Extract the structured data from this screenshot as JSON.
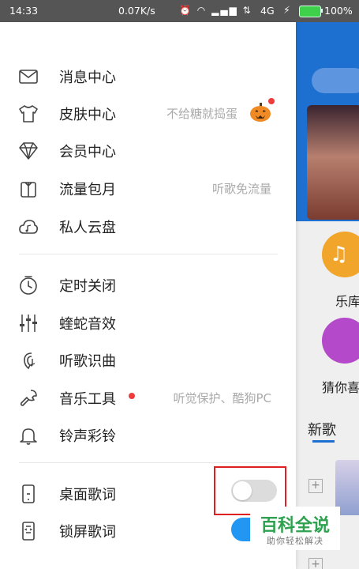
{
  "status_bar": {
    "time": "14:33",
    "net_speed": "0.07K/s",
    "network": "4G",
    "battery": "100%",
    "battery_level": 1.0
  },
  "drawer": {
    "group1": [
      {
        "label": "消息中心",
        "hint": "",
        "icon": "mail-icon"
      },
      {
        "label": "皮肤中心",
        "hint": "不给糖就捣蛋",
        "icon": "tshirt-icon"
      },
      {
        "label": "会员中心",
        "hint": "",
        "icon": "diamond-icon"
      },
      {
        "label": "流量包月",
        "hint": "听歌免流量",
        "icon": "gift-icon"
      },
      {
        "label": "私人云盘",
        "hint": "",
        "icon": "cloud-music-icon"
      }
    ],
    "group2": [
      {
        "label": "定时关闭",
        "hint": "",
        "icon": "timer-icon"
      },
      {
        "label": "蝰蛇音效",
        "hint": "",
        "icon": "equalizer-icon"
      },
      {
        "label": "听歌识曲",
        "hint": "",
        "icon": "mic-music-icon"
      },
      {
        "label": "音乐工具",
        "hint": "听觉保护、酷狗PC",
        "icon": "wrench-icon"
      },
      {
        "label": "铃声彩铃",
        "hint": "",
        "icon": "bell-icon"
      }
    ],
    "group3": [
      {
        "label": "桌面歌词",
        "icon": "desktop-lyrics-icon",
        "toggle": false
      },
      {
        "label": "锁屏歌词",
        "icon": "lockscreen-lyrics-icon",
        "toggle": true
      }
    ]
  },
  "background_app": {
    "label_music": "乐库",
    "label_guess": "猜你喜",
    "section_title": "新歌"
  },
  "watermark": {
    "title": "百科全说",
    "subtitle": "助你轻松解决"
  },
  "colors": {
    "accent_blue": "#2196f3",
    "red_dot": "#ee3c3c",
    "highlight_box": "#e02020",
    "battery_green": "#3ed04a",
    "watermark_green": "#2ea14f"
  }
}
